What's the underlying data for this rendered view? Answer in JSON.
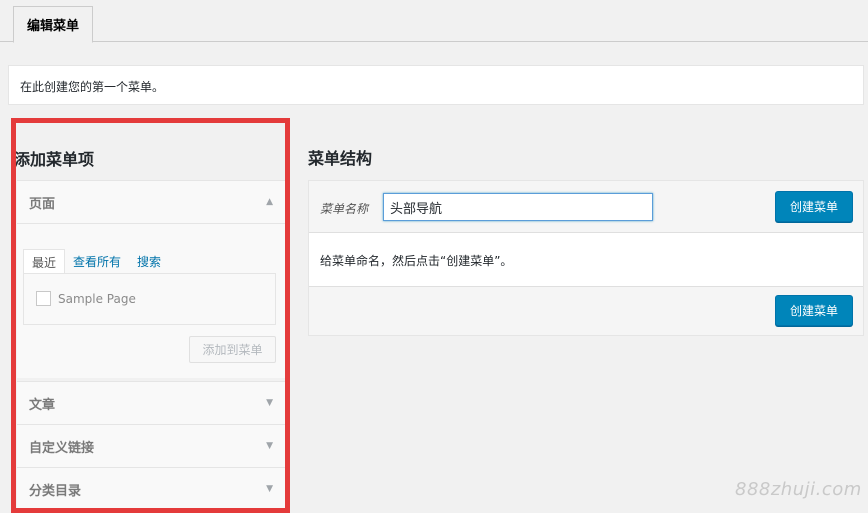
{
  "tabs": {
    "edit_menu": "编辑菜单"
  },
  "notice": {
    "text": "在此创建您的第一个菜单。"
  },
  "add_items": {
    "title": "添加菜单项",
    "sections": [
      {
        "label": "页面",
        "expanded": true
      },
      {
        "label": "文章",
        "expanded": false
      },
      {
        "label": "自定义链接",
        "expanded": false
      },
      {
        "label": "分类目录",
        "expanded": false
      }
    ],
    "pages": {
      "sub_tabs": [
        "最近",
        "查看所有",
        "搜索"
      ],
      "items": [
        {
          "label": "Sample Page",
          "checked": false
        }
      ],
      "add_button": "添加到菜单"
    }
  },
  "menu_structure": {
    "title": "菜单结构",
    "name_label": "菜单名称",
    "name_value": "头部导航",
    "create_button": "创建菜单",
    "hint": "给菜单命名，然后点击“创建菜单”。",
    "create_button_bottom": "创建菜单"
  },
  "watermark": "888zhuji.com",
  "colors": {
    "primary": "#0085ba",
    "highlight_border": "#e43b3b"
  }
}
